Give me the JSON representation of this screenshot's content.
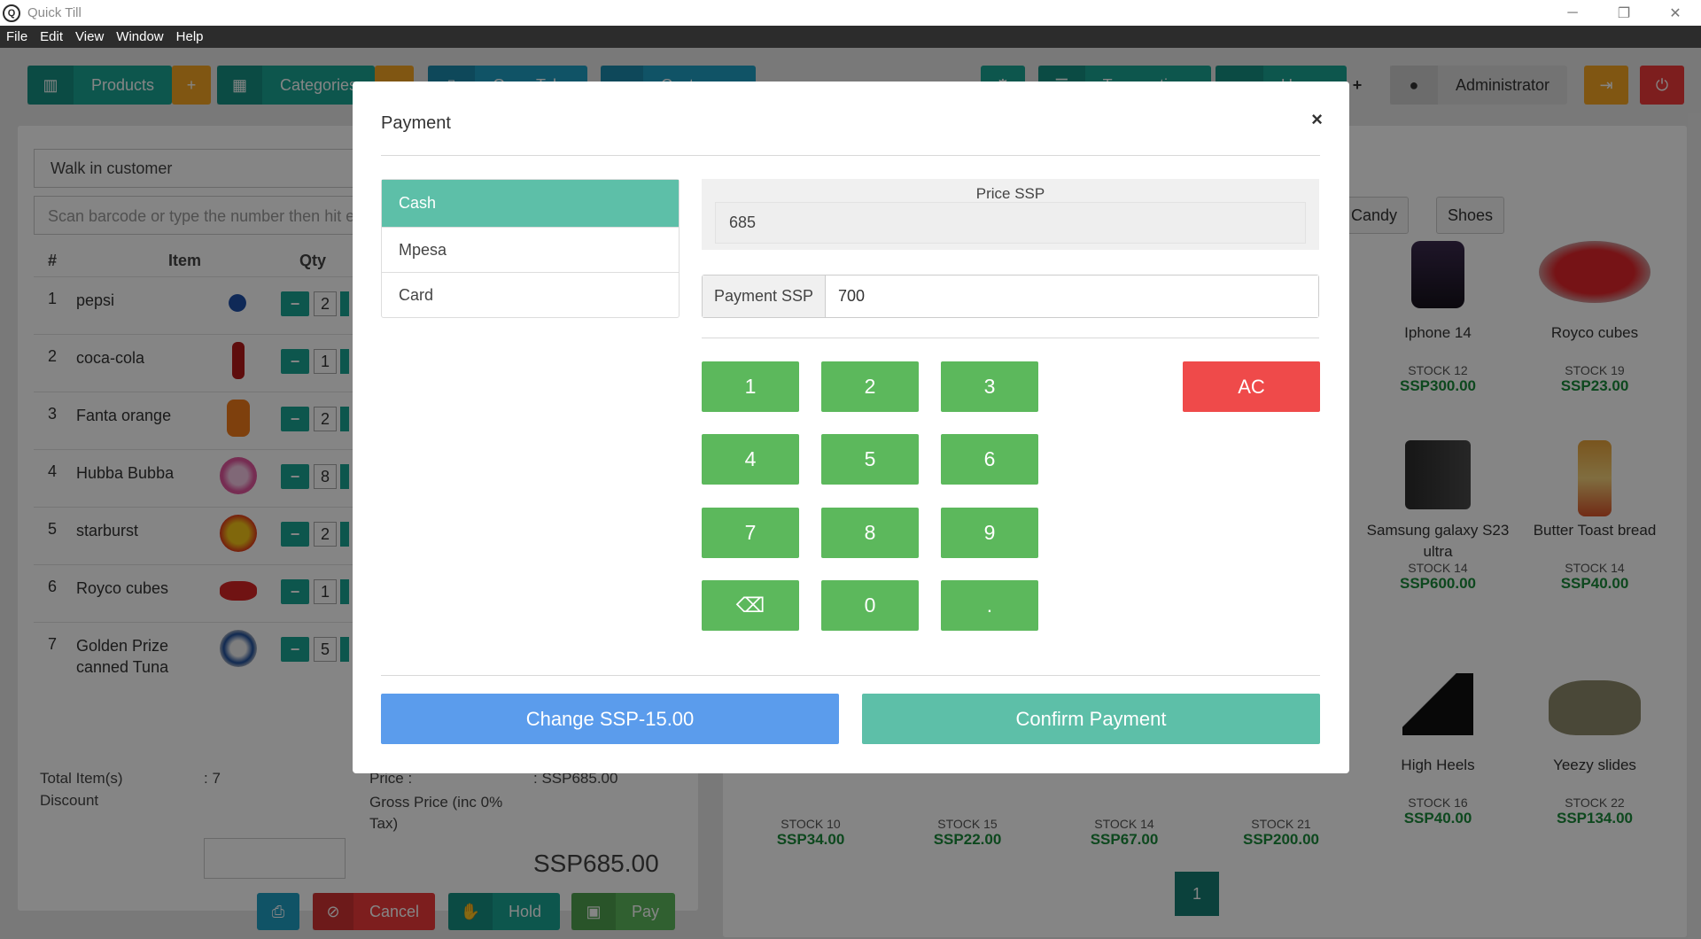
{
  "window": {
    "title": "Quick Till",
    "icon_label": "Q",
    "controls": {
      "minimize": "─",
      "restore": "❐",
      "close": "✕"
    }
  },
  "menu": [
    "File",
    "Edit",
    "View",
    "Window",
    "Help"
  ],
  "toolbar": {
    "products_label": "Products",
    "add_product_label": "+",
    "categories_label": "Categories",
    "open_tabs_label": "Open Tabs",
    "customers_label": "Customers",
    "transactions_label": "Transactions",
    "users_label": "Users",
    "plus_label": "+",
    "user_name": "Administrator"
  },
  "customer": {
    "selected": "Walk in customer",
    "scan_placeholder": "Scan barcode or type the number then hit enter"
  },
  "cart": {
    "headers": {
      "num": "#",
      "item": "Item",
      "qty": "Qty"
    },
    "rows": [
      {
        "num": "1",
        "name": "pepsi",
        "qty": "2"
      },
      {
        "num": "2",
        "name": "coca-cola",
        "qty": "1"
      },
      {
        "num": "3",
        "name": "Fanta orange",
        "qty": "2"
      },
      {
        "num": "4",
        "name": "Hubba Bubba",
        "qty": "8"
      },
      {
        "num": "5",
        "name": "starburst",
        "qty": "2"
      },
      {
        "num": "6",
        "name": "Royco cubes",
        "qty": "1"
      },
      {
        "num": "7",
        "name": "Golden Prize canned Tuna",
        "qty": "5"
      }
    ],
    "total_items_label": "Total Item(s)",
    "total_items_value": ": 7",
    "discount_label": "Discount",
    "price_label": "Price :",
    "price_value": ": SSP685.00",
    "gross_label": "Gross Price (inc 0% Tax)",
    "gross_value": "SSP685.00"
  },
  "actions": {
    "cancel": "Cancel",
    "hold": "Hold",
    "pay": "Pay"
  },
  "categories": [
    "Candy",
    "Shoes"
  ],
  "products": [
    {
      "name": "Iphone 14",
      "stock": "STOCK 12",
      "price": "SSP300.00"
    },
    {
      "name": "Royco cubes",
      "stock": "STOCK 19",
      "price": "SSP23.00"
    },
    {
      "name": "Samsung galaxy S23 ultra",
      "stock": "STOCK 14",
      "price": "SSP600.00"
    },
    {
      "name": "Butter Toast bread",
      "stock": "STOCK 14",
      "price": "SSP40.00"
    },
    {
      "name": "High Heels",
      "stock": "STOCK 16",
      "price": "SSP40.00"
    },
    {
      "name": "Yeezy slides",
      "stock": "STOCK 22",
      "price": "SSP134.00"
    }
  ],
  "bottom_stock": [
    {
      "stock": "STOCK 10",
      "price": "SSP34.00"
    },
    {
      "stock": "STOCK 15",
      "price": "SSP22.00"
    },
    {
      "stock": "STOCK 14",
      "price": "SSP67.00"
    },
    {
      "stock": "STOCK 21",
      "price": "SSP200.00"
    }
  ],
  "pagination": {
    "current": "1"
  },
  "modal": {
    "title": "Payment",
    "close": "×",
    "methods": [
      "Cash",
      "Mpesa",
      "Card"
    ],
    "active_method": "Cash",
    "price_label": "Price SSP",
    "price_value": "685",
    "payment_label": "Payment SSP",
    "payment_value": "700",
    "keys": [
      "1",
      "2",
      "3",
      "4",
      "5",
      "6",
      "7",
      "8",
      "9",
      "⌫",
      "0",
      "."
    ],
    "clear_label": "AC",
    "change_label": "Change SSP-15.00",
    "confirm_label": "Confirm Payment"
  },
  "colors": {
    "teal": "#1aa595",
    "accent_green": "#5cb85c",
    "mint": "#5dbfa8",
    "blue": "#5b9cec",
    "danger": "#ef4a4a",
    "orange": "#f5a623"
  }
}
